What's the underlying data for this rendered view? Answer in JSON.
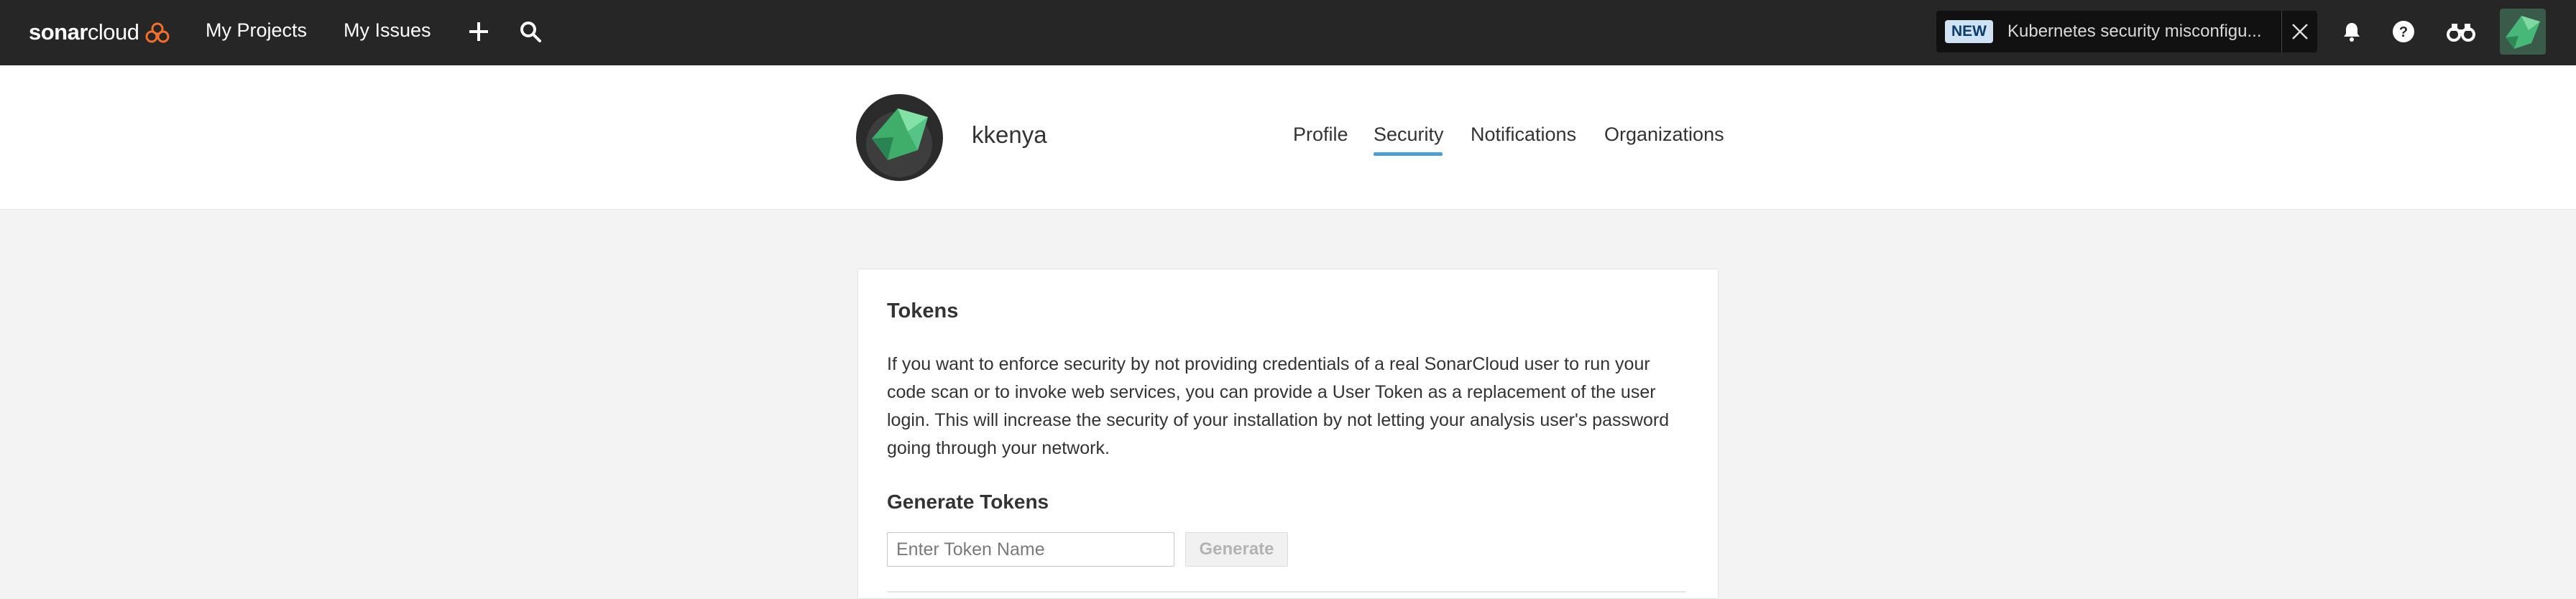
{
  "brand": {
    "name_bold": "sonar",
    "name_light": "cloud",
    "accent": "#f3702a"
  },
  "nav": {
    "projects": "My Projects",
    "issues": "My Issues"
  },
  "notice": {
    "badge": "NEW",
    "text": "Kubernetes security misconfigu..."
  },
  "icons": [
    "plus-icon",
    "search-icon",
    "close-icon",
    "bell-icon",
    "help-icon",
    "binoculars-icon"
  ],
  "profile": {
    "username": "kkenya",
    "tabs": [
      {
        "label": "Profile",
        "active": false
      },
      {
        "label": "Security",
        "active": true
      },
      {
        "label": "Notifications",
        "active": false
      },
      {
        "label": "Organizations",
        "active": false
      }
    ]
  },
  "tokens": {
    "title": "Tokens",
    "description": "If you want to enforce security by not providing credentials of a real SonarCloud user to run your code scan or to invoke web services, you can provide a User Token as a replacement of the user login. This will increase the security of your installation by not letting your analysis user's password going through your network.",
    "generate_title": "Generate Tokens",
    "input_placeholder": "Enter Token Name",
    "input_value": "",
    "generate_label": "Generate"
  },
  "colors": {
    "topbar": "#262626",
    "tab_active": "#4b9fd5",
    "avatar_green": "#3fae6b"
  }
}
